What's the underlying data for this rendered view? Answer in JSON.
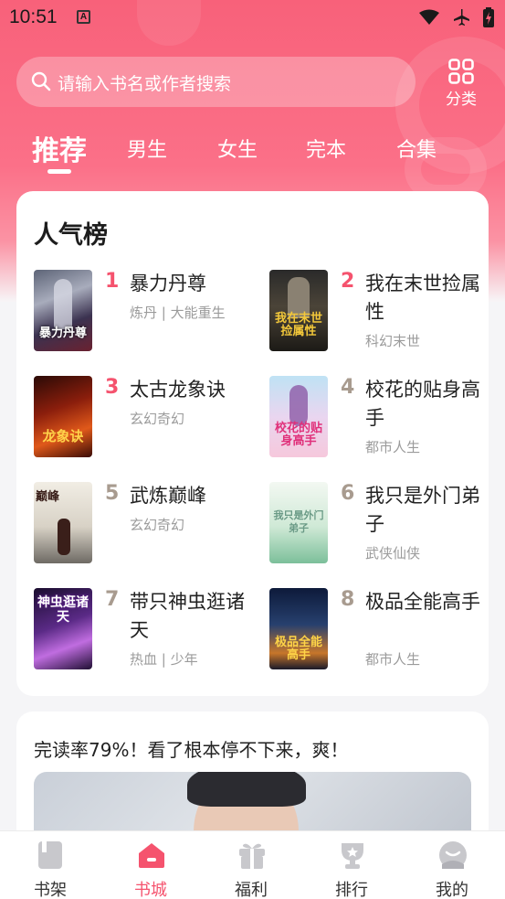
{
  "status_bar": {
    "time": "10:51",
    "sim_label": "A"
  },
  "search": {
    "placeholder": "请输入书名或作者搜索"
  },
  "category_button": {
    "label": "分类"
  },
  "tabs": [
    {
      "label": "推荐",
      "active": true
    },
    {
      "label": "男生"
    },
    {
      "label": "女生"
    },
    {
      "label": "完本"
    },
    {
      "label": "合集"
    }
  ],
  "ranking": {
    "title": "人气榜",
    "items": [
      {
        "rank": "1",
        "title": "暴力丹尊",
        "tags": "炼丹 | 大能重生",
        "cover_text": "暴力丹尊",
        "rank_color": "#f5536e"
      },
      {
        "rank": "2",
        "title": "我在末世捡属性",
        "tags": "科幻末世",
        "cover_text": "我在末世捡属性",
        "rank_color": "#f5536e"
      },
      {
        "rank": "3",
        "title": "太古龙象诀",
        "tags": "玄幻奇幻",
        "cover_text": "龙象诀",
        "rank_color": "#f5536e"
      },
      {
        "rank": "4",
        "title": "校花的贴身高手",
        "tags": "都市人生",
        "cover_text": "校花的贴身高手",
        "rank_color": "#a89b8f"
      },
      {
        "rank": "5",
        "title": "武炼巅峰",
        "tags": "玄幻奇幻",
        "cover_text": "巅峰",
        "rank_color": "#a89b8f"
      },
      {
        "rank": "6",
        "title": "我只是外门弟子",
        "tags": "武侠仙侠",
        "cover_text": "我只是外门弟子",
        "rank_color": "#a89b8f"
      },
      {
        "rank": "7",
        "title": "带只神虫逛诸天",
        "tags": "热血 | 少年",
        "cover_text": "神虫逛诸天",
        "rank_color": "#a89b8f"
      },
      {
        "rank": "8",
        "title": "极品全能高手",
        "tags": "都市人生",
        "cover_text": "极品全能高手",
        "rank_color": "#a89b8f"
      }
    ]
  },
  "promo": {
    "headline": "完读率79%！看了根本停不下来，爽！"
  },
  "bottom_nav": [
    {
      "label": "书架",
      "icon": "book-icon"
    },
    {
      "label": "书城",
      "icon": "home-icon",
      "active": true
    },
    {
      "label": "福利",
      "icon": "gift-icon"
    },
    {
      "label": "排行",
      "icon": "trophy-icon"
    },
    {
      "label": "我的",
      "icon": "user-icon"
    }
  ],
  "colors": {
    "accent": "#f5536e",
    "hero_top": "#f8617a",
    "rank_muted": "#a89b8f"
  }
}
